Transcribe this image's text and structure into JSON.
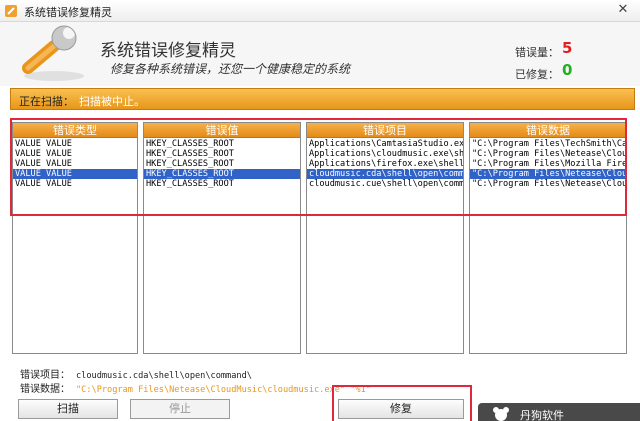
{
  "window": {
    "title": "系统错误修复精灵"
  },
  "header": {
    "title": "系统错误修复精灵",
    "subtitle": "修复各种系统错误，还您一个健康稳定的系统",
    "errors_label": "错误量：",
    "errors_value": "5",
    "fixed_label": "已修复：",
    "fixed_value": "0"
  },
  "scan": {
    "label": "正在扫描：",
    "status": "扫描被中止。"
  },
  "columns": [
    {
      "header": "错误类型",
      "rows": [
        "VALUE VALUE",
        "VALUE VALUE",
        "VALUE VALUE",
        "VALUE VALUE",
        "VALUE VALUE"
      ]
    },
    {
      "header": "错误值",
      "rows": [
        "HKEY_CLASSES_ROOT",
        "HKEY_CLASSES_ROOT",
        "HKEY_CLASSES_ROOT",
        "HKEY_CLASSES_ROOT",
        "HKEY_CLASSES_ROOT"
      ]
    },
    {
      "header": "错误项目",
      "rows": [
        "Applications\\CamtasiaStudio.exe\\",
        "Applications\\cloudmusic.exe\\shel",
        "Applications\\firefox.exe\\shell\\",
        "cloudmusic.cda\\shell\\open\\command",
        "cloudmusic.cue\\shell\\open\\comman"
      ]
    },
    {
      "header": "错误数据",
      "rows": [
        "\"C:\\Program Files\\TechSmith\\Cam",
        "\"C:\\Program Files\\Netease\\Cloud",
        "\"C:\\Program Files\\Mozilla Firef",
        "\"C:\\Program Files\\Netease\\Cloud",
        "\"C:\\Program Files\\Netease\\Cloud"
      ]
    }
  ],
  "selected_row": 3,
  "detail": {
    "item_label": "错误项目：",
    "item_value": "cloudmusic.cda\\shell\\open\\command\\",
    "data_label": "错误数据：",
    "data_value": "\"C:\\Program Files\\Netease\\CloudMusic\\cloudmusic.exe\" \"%1\""
  },
  "buttons": {
    "scan": "扫描",
    "stop": "停止",
    "repair": "修复"
  },
  "watermark": {
    "text": "丹狗软件"
  },
  "colors": {
    "accent": "#e8961a",
    "selection": "#3162c7",
    "error": "#e02020",
    "ok": "#20b020",
    "annotation": "#e0283c"
  }
}
